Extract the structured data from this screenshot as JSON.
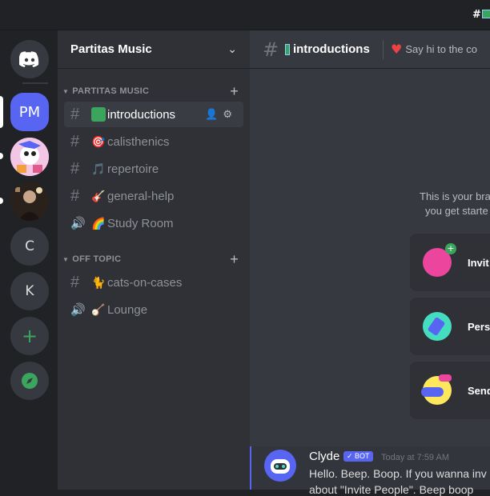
{
  "window": {
    "title": "#"
  },
  "servers": {
    "items": [
      {
        "label": "",
        "icon": "discord-home-icon"
      },
      {
        "label": "PM",
        "active": true
      },
      {
        "label": "",
        "icon": "avatar-art"
      },
      {
        "label": "",
        "icon": "avatar-photo"
      },
      {
        "label": "C"
      },
      {
        "label": "K"
      },
      {
        "label": "+",
        "icon": "add-server-icon"
      },
      {
        "label": "",
        "icon": "explore-compass-icon"
      }
    ]
  },
  "guild": {
    "name": "Partitas Music",
    "categories": [
      {
        "name": "PARTITAS MUSIC",
        "channels": [
          {
            "name": "introductions",
            "type": "text",
            "emoji": "🗺",
            "active": true
          },
          {
            "name": "calisthenics",
            "type": "text",
            "emoji": "🎯"
          },
          {
            "name": "repertoire",
            "type": "text",
            "emoji": "🎵"
          },
          {
            "name": "general-help",
            "type": "text",
            "emoji": "🎸"
          },
          {
            "name": "Study Room",
            "type": "voice",
            "emoji": "🌈"
          }
        ]
      },
      {
        "name": "OFF TOPIC",
        "channels": [
          {
            "name": "cats-on-cases",
            "type": "text",
            "emoji": "🐈"
          },
          {
            "name": "Lounge",
            "type": "voice",
            "emoji": "🪕"
          }
        ]
      }
    ]
  },
  "channel_header": {
    "name": "introductions",
    "topic": "Say hi to the co"
  },
  "welcome": {
    "line1": "This is your bra",
    "line2": "you get starte"
  },
  "cards": [
    {
      "label": "Invit",
      "icon": "invite-friends-icon"
    },
    {
      "label": "Perso",
      "icon": "personalize-brush-icon"
    },
    {
      "label": "Send",
      "icon": "send-message-icon"
    }
  ],
  "message": {
    "author": "Clyde",
    "badge": "✓ BOT",
    "time": "Today at 7:59 AM",
    "text": "Hello. Beep. Boop. If you wanna inv",
    "text2": "about \"Invite People\". Beep boop"
  },
  "colors": {
    "blurple": "#5865f2",
    "green": "#3ba55d",
    "red": "#ed4245",
    "background": "#36393f"
  }
}
